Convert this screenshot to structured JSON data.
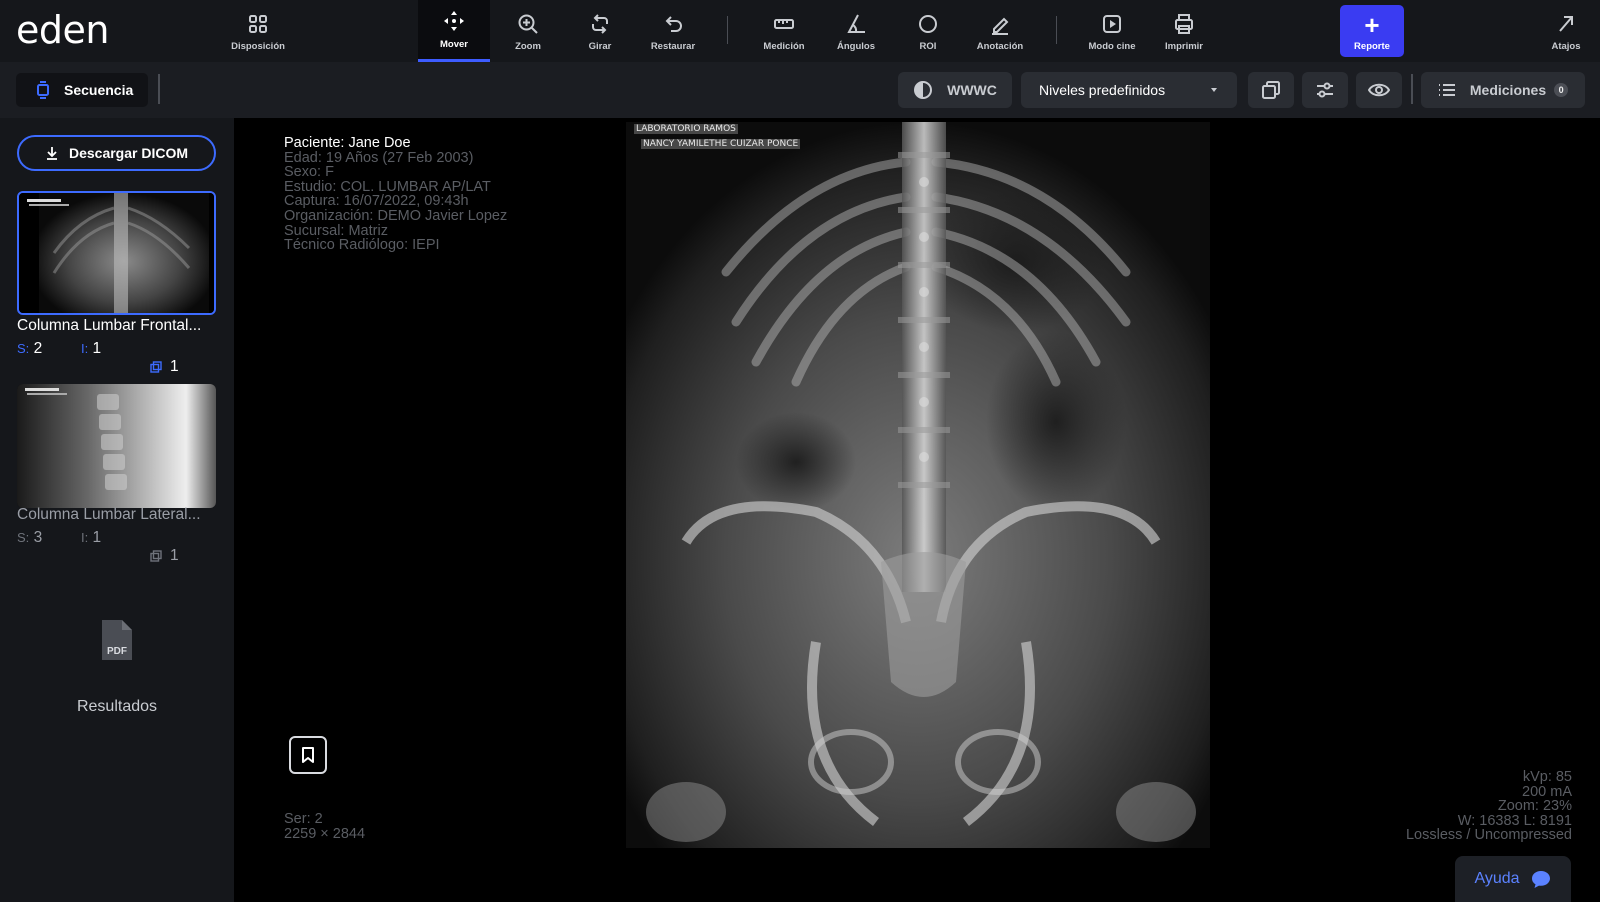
{
  "app": {
    "logo": "eden"
  },
  "toolbar": {
    "tools": [
      {
        "id": "disposicion",
        "label": "Disposición",
        "icon": "grid-icon"
      },
      {
        "id": "mover",
        "label": "Mover",
        "icon": "move-icon",
        "active": true
      },
      {
        "id": "zoom",
        "label": "Zoom",
        "icon": "zoom-icon"
      },
      {
        "id": "girar",
        "label": "Girar",
        "icon": "rotate-icon"
      },
      {
        "id": "restaurar",
        "label": "Restaurar",
        "icon": "undo-icon"
      },
      {
        "id": "medicion",
        "label": "Medición",
        "icon": "ruler-icon"
      },
      {
        "id": "angulos",
        "label": "Ángulos",
        "icon": "angle-icon"
      },
      {
        "id": "roi",
        "label": "ROI",
        "icon": "circle-icon"
      },
      {
        "id": "anotacion",
        "label": "Anotación",
        "icon": "pencil-icon"
      },
      {
        "id": "modo_cine",
        "label": "Modo cine",
        "icon": "play-icon"
      },
      {
        "id": "imprimir",
        "label": "Imprimir",
        "icon": "printer-icon"
      },
      {
        "id": "atajos",
        "label": "Atajos",
        "icon": "arrow-up-right-icon"
      }
    ],
    "reporte": {
      "label": "Reporte",
      "icon": "plus-icon"
    }
  },
  "subbar": {
    "secuencia": "Secuencia",
    "wwwc": "WWWC",
    "niveles": "Niveles predefinidos",
    "mediciones": "Mediciones",
    "mediciones_count": "0"
  },
  "sidebar": {
    "download": "Descargar DICOM",
    "series": [
      {
        "name": "Columna Lumbar Frontal...",
        "s_key": "S:",
        "s": "2",
        "i_key": "I:",
        "i": "1",
        "c": "1",
        "selected": true
      },
      {
        "name": "Columna Lumbar Lateral...",
        "s_key": "S:",
        "s": "3",
        "i_key": "I:",
        "i": "1",
        "c": "1",
        "selected": false
      }
    ],
    "pdf_label": "PDF",
    "resultados": "Resultados"
  },
  "viewer": {
    "overlay_top_left": [
      "Paciente: Jane Doe",
      "Edad: 19 Años (27 Feb 2003)",
      "Sexo: F",
      "Estudio: COL. LUMBAR AP/LAT",
      "Captura: 16/07/2022, 09:43h",
      "Organización: DEMO Javier Lopez",
      "Sucursal: Matriz",
      "Técnico Radiólogo: IEPI"
    ],
    "overlay_bottom_left": [
      "Ser: 2",
      "2259 × 2844"
    ],
    "overlay_bottom_right": [
      "kVp: 85",
      "200 mA",
      "Zoom: 23%",
      "W: 16383 L: 8191",
      "Lossless / Uncompressed"
    ],
    "image_labels": [
      "LABORATORIO RAMOS",
      "NANCY YAMILETHE CUIZAR PONCE"
    ],
    "help": "Ayuda"
  },
  "colors": {
    "accent": "#3d5cff",
    "report_button": "#3a3cf2",
    "background": "#000000"
  }
}
